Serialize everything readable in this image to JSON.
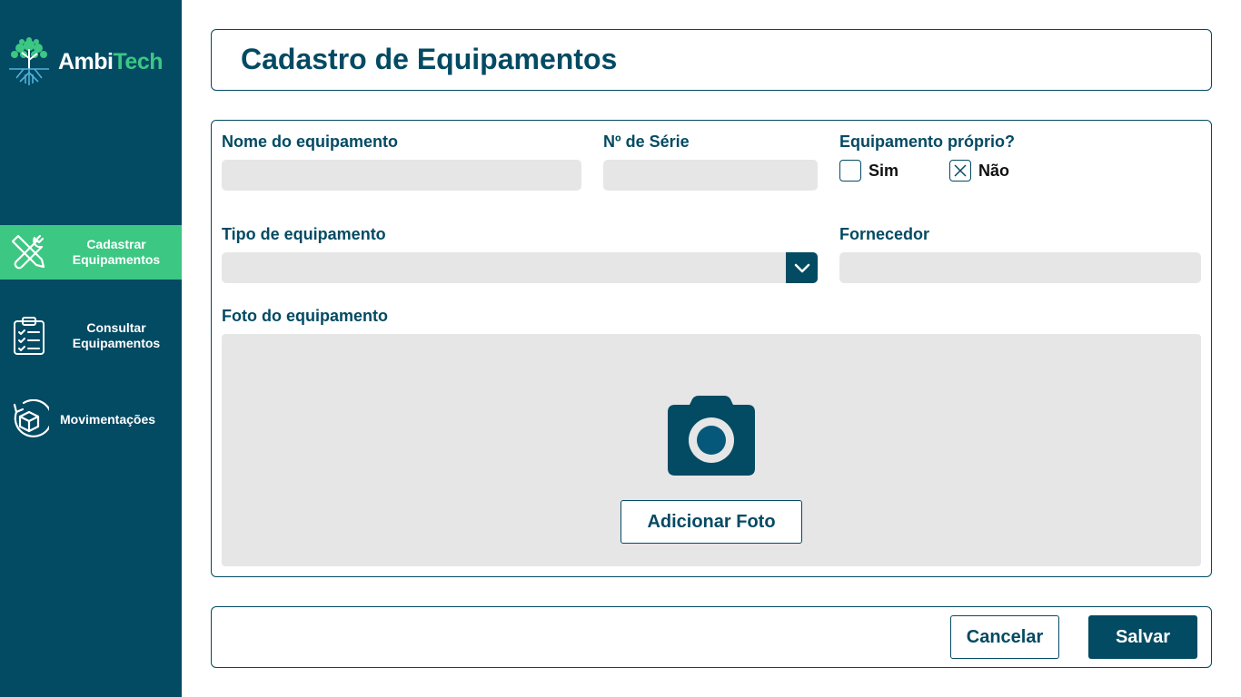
{
  "brand": {
    "name_part1": "Ambi",
    "name_part2": "Tech",
    "primary_color": "#034A63",
    "accent_color": "#3CC783"
  },
  "sidebar": {
    "items": [
      {
        "label": "Cadastrar Equipamentos",
        "icon": "tools-icon",
        "active": true
      },
      {
        "label": "Consultar Equipamentos",
        "icon": "clipboard-checklist-icon",
        "active": false
      },
      {
        "label": "Movimentações",
        "icon": "box-rotate-icon",
        "active": false
      }
    ]
  },
  "page": {
    "title": "Cadastro de Equipamentos"
  },
  "form": {
    "equipment_name": {
      "label": "Nome do equipamento",
      "value": ""
    },
    "serial_number": {
      "label": "Nº de Série",
      "value": ""
    },
    "own_equipment": {
      "label": "Equipamento próprio?",
      "options": [
        {
          "label": "Sim",
          "checked": false
        },
        {
          "label": "Não",
          "checked": true
        }
      ]
    },
    "equipment_type": {
      "label": "Tipo de equipamento",
      "value": ""
    },
    "supplier": {
      "label": "Fornecedor",
      "value": ""
    },
    "photo": {
      "label": "Foto do equipamento",
      "add_label": "Adicionar Foto"
    }
  },
  "footer": {
    "cancel_label": "Cancelar",
    "save_label": "Salvar"
  }
}
